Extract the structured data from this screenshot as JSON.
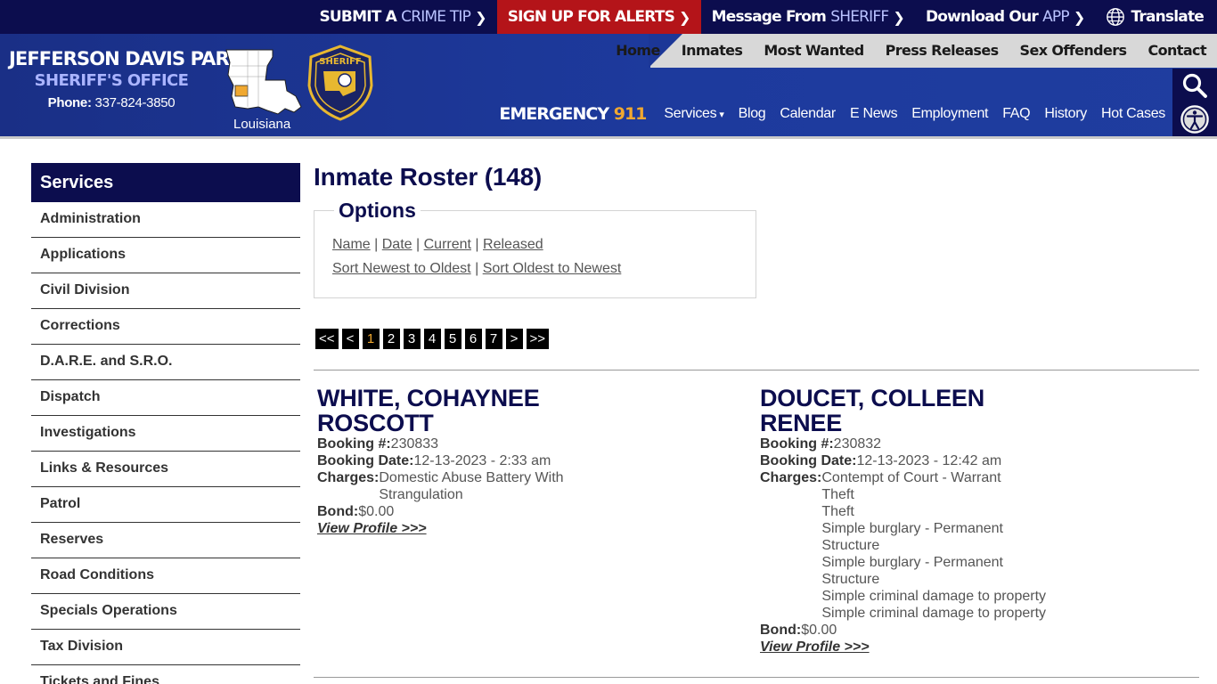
{
  "topbar": {
    "crime_tip": {
      "a": "Submit a",
      "b": "Crime Tip"
    },
    "alerts": "Sign up for alerts",
    "message": {
      "a": "Message From",
      "b": "SHERIFF"
    },
    "download": {
      "a": "Download Our",
      "b": "APP"
    },
    "translate": "Translate"
  },
  "brand": {
    "line1": "JEFFERSON DAVIS PARISH",
    "line2": "SHERIFF'S OFFICE",
    "phone_label": "Phone:",
    "phone": "337-824-3850",
    "map_label": "Louisiana",
    "badge_text": "SHERIFF"
  },
  "mainnav": [
    "Home",
    "Inmates",
    "Most Wanted",
    "Press Releases",
    "Sex Offenders",
    "Contact"
  ],
  "secnav": {
    "emergency_label": "EMERGENCY",
    "emergency_number": "911",
    "items": [
      "Services",
      "Blog",
      "Calendar",
      "E News",
      "Employment",
      "FAQ",
      "History",
      "Hot Cases"
    ]
  },
  "sidebar": {
    "title": "Services",
    "items": [
      "Administration",
      "Applications",
      "Civil Division",
      "Corrections",
      "D.A.R.E. and S.R.O.",
      "Dispatch",
      "Investigations",
      "Links & Resources",
      "Patrol",
      "Reserves",
      "Road Conditions",
      "Specials Operations",
      "Tax Division",
      "Tickets and Fines"
    ]
  },
  "main": {
    "title": "Inmate Roster (148)",
    "options": {
      "legend": "Options",
      "row1": [
        "Name",
        "Date",
        "Current",
        "Released"
      ],
      "row2": [
        "Sort Newest to Oldest",
        "Sort Oldest to Newest"
      ],
      "separator": "|"
    },
    "pager": [
      "<<",
      "<",
      "1",
      "2",
      "3",
      "4",
      "5",
      "6",
      "7",
      ">",
      ">>"
    ],
    "current_page": "1",
    "labels": {
      "booking_no": "Booking #:",
      "booking_date": "Booking Date:",
      "charges": "Charges:",
      "bond": "Bond:",
      "view": "View Profile >>>"
    },
    "inmates": [
      {
        "name": "WHITE, COHAYNEE ROSCOTT",
        "booking_no": "230833",
        "booking_date": "12-13-2023 - 2:33 am",
        "charges": [
          "Domestic Abuse Battery With",
          "Strangulation"
        ],
        "bond": "$0.00"
      },
      {
        "name": "DOUCET, COLLEEN RENEE",
        "booking_no": "230832",
        "booking_date": "12-13-2023 - 12:42 am",
        "charges": [
          "Contempt of Court - Warrant",
          "Theft",
          "Theft",
          "Simple burglary - Permanent",
          "Structure",
          "Simple burglary - Permanent",
          "Structure",
          "Simple criminal damage to property",
          "Simple criminal damage to property"
        ],
        "bond": "$0.00"
      }
    ]
  },
  "colors": {
    "navy": "#0c0d4e",
    "header_blue": "#1d3a9d",
    "alert_red": "#b41419",
    "accent_gold": "#f0a830"
  }
}
